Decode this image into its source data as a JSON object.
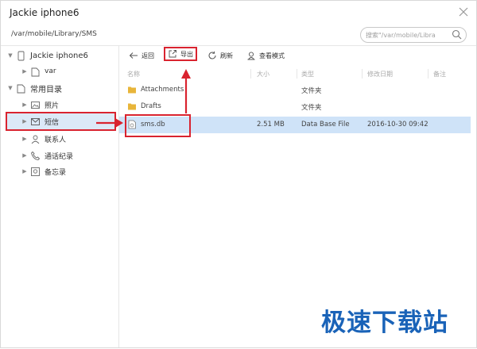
{
  "window": {
    "title": "Jackie iphone6"
  },
  "path": {
    "current": "/var/mobile/Library/SMS"
  },
  "search": {
    "placeholder": "搜索\"/var/mobile/Libra"
  },
  "sidebar": {
    "items": [
      {
        "label": "Jackie iphone6",
        "icon": "phone-icon"
      },
      {
        "label": "var",
        "icon": "folder-outline-icon"
      },
      {
        "label": "常用目录",
        "icon": "folder-outline-icon"
      },
      {
        "label": "照片",
        "icon": "photo-icon"
      },
      {
        "label": "短信",
        "icon": "message-icon"
      },
      {
        "label": "联系人",
        "icon": "contact-icon"
      },
      {
        "label": "通话纪录",
        "icon": "phone-call-icon"
      },
      {
        "label": "备忘录",
        "icon": "memo-icon"
      }
    ]
  },
  "toolbar": {
    "back_label": "返回",
    "export_label": "导出",
    "refresh_label": "刷新",
    "view_mode_label": "查看模式"
  },
  "table": {
    "columns": [
      "名称",
      "大小",
      "类型",
      "修改日期",
      "备注"
    ],
    "rows": [
      {
        "name": "Attachments",
        "size": "",
        "type": "文件夹",
        "date": "",
        "icon": "folder-icon"
      },
      {
        "name": "Drafts",
        "size": "",
        "type": "文件夹",
        "date": "",
        "icon": "folder-icon"
      },
      {
        "name": "sms.db",
        "size": "2.51 MB",
        "type": "Data Base File",
        "date": "2016-10-30 09:42",
        "icon": "database-file-icon"
      }
    ]
  },
  "watermark": {
    "text": "极速下载站"
  },
  "colors": {
    "accent_red": "#d9232f",
    "selected_row": "#cfe3f8",
    "folder_yellow": "#e8b53a",
    "watermark_blue": "#1a63b8"
  }
}
